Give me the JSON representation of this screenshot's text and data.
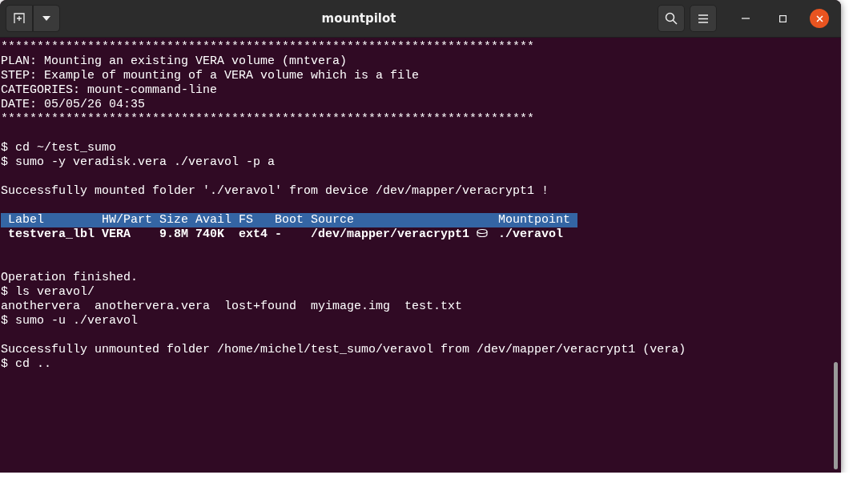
{
  "window": {
    "title": "mountpilot"
  },
  "terminal": {
    "lines": [
      {
        "kind": "text",
        "text": "**************************************************************************"
      },
      {
        "kind": "text",
        "text": "PLAN: Mounting an existing VERA volume (mntvera)"
      },
      {
        "kind": "text",
        "text": "STEP: Example of mounting of a VERA volume which is a file"
      },
      {
        "kind": "text",
        "text": "CATEGORIES: mount-command-line"
      },
      {
        "kind": "text",
        "text": "DATE: 05/05/26 04:35"
      },
      {
        "kind": "text",
        "text": "**************************************************************************"
      },
      {
        "kind": "blank"
      },
      {
        "kind": "text",
        "text": "$ cd ~/test_sumo"
      },
      {
        "kind": "text",
        "text": "$ sumo -y veradisk.vera ./veravol -p a"
      },
      {
        "kind": "blank"
      },
      {
        "kind": "text",
        "text": "Successfully mounted folder './veravol' from device /dev/mapper/veracrypt1 !"
      },
      {
        "kind": "blank"
      },
      {
        "kind": "table",
        "columns": [
          "Label",
          "HW/Part",
          "Size",
          "Avail",
          "FS",
          "Boot",
          "Source",
          "Mountpoint"
        ],
        "rows": [
          [
            "testvera_lbl",
            "VERA",
            "9.8M",
            "740K",
            "ext4",
            "-",
            "/dev/mapper/veracrypt1",
            "./veravol"
          ]
        ]
      },
      {
        "kind": "blank"
      },
      {
        "kind": "blank"
      },
      {
        "kind": "text",
        "text": "Operation finished."
      },
      {
        "kind": "text",
        "text": "$ ls veravol/"
      },
      {
        "kind": "text",
        "text": "anothervera  anothervera.vera  lost+found  myimage.img  test.txt"
      },
      {
        "kind": "text",
        "text": "$ sumo -u ./veravol"
      },
      {
        "kind": "blank"
      },
      {
        "kind": "text",
        "text": "Successfully unmounted folder /home/michel/test_sumo/veravol from /dev/mapper/veracrypt1 (vera)"
      },
      {
        "kind": "text",
        "text": "$ cd .."
      }
    ]
  }
}
